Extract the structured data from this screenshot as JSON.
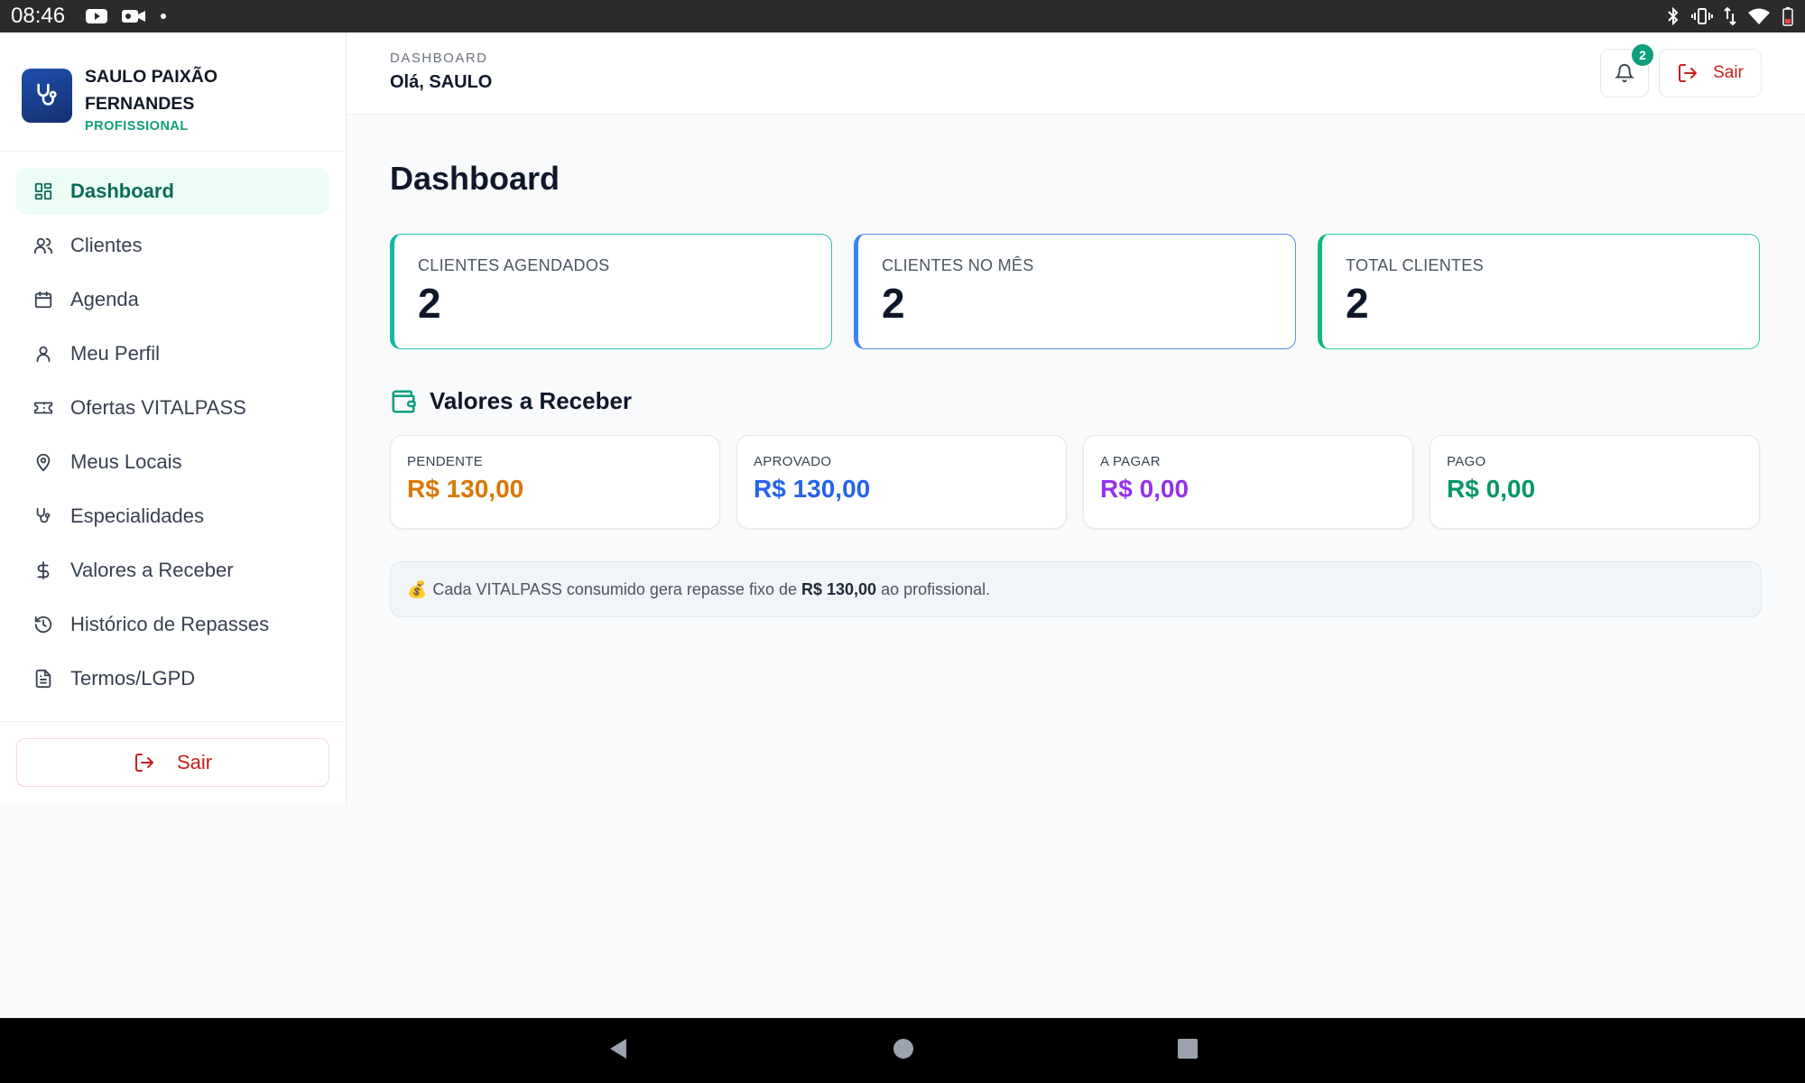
{
  "status_bar": {
    "time": "08:46"
  },
  "sidebar": {
    "profile": {
      "name": "SAULO PAIXÃO FERNANDES",
      "role": "PROFISSIONAL"
    },
    "items": [
      {
        "label": "Dashboard",
        "icon": "grid-icon",
        "active": true
      },
      {
        "label": "Clientes",
        "icon": "users-icon"
      },
      {
        "label": "Agenda",
        "icon": "calendar-icon"
      },
      {
        "label": "Meu Perfil",
        "icon": "user-icon"
      },
      {
        "label": "Ofertas VITALPASS",
        "icon": "ticket-icon"
      },
      {
        "label": "Meus Locais",
        "icon": "map-pin-icon"
      },
      {
        "label": "Especialidades",
        "icon": "stethoscope-icon"
      },
      {
        "label": "Valores a Receber",
        "icon": "dollar-icon"
      },
      {
        "label": "Histórico de Repasses",
        "icon": "history-icon"
      },
      {
        "label": "Termos/LGPD",
        "icon": "document-icon"
      }
    ],
    "logout_label": "Sair"
  },
  "header": {
    "breadcrumb": "DASHBOARD",
    "greeting": "Olá, SAULO",
    "notification_count": "2",
    "logout_label": "Sair"
  },
  "main": {
    "title": "Dashboard",
    "stats": [
      {
        "label": "CLIENTES AGENDADOS",
        "value": "2",
        "color": "#14b8a6"
      },
      {
        "label": "CLIENTES NO MÊS",
        "value": "2",
        "color": "#3b82f6"
      },
      {
        "label": "TOTAL CLIENTES",
        "value": "2",
        "color": "#10b981"
      }
    ],
    "receivables": {
      "title": "Valores a Receber",
      "cards": [
        {
          "label": "PENDENTE",
          "value": "R$ 130,00",
          "color": "#d97706"
        },
        {
          "label": "APROVADO",
          "value": "R$ 130,00",
          "color": "#2563eb"
        },
        {
          "label": "A PAGAR",
          "value": "R$ 0,00",
          "color": "#9333ea"
        },
        {
          "label": "PAGO",
          "value": "R$ 0,00",
          "color": "#059669"
        }
      ],
      "info": {
        "emoji": "💰",
        "prefix": "Cada VITALPASS consumido gera repasse fixo de",
        "amount": "R$ 130,00",
        "suffix": "ao profissional."
      }
    }
  }
}
